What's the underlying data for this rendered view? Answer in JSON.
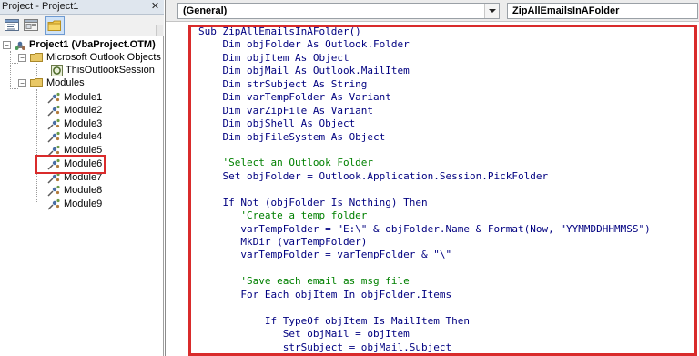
{
  "project_pane": {
    "title": "Project - Project1",
    "close_glyph": "✕",
    "toolbar": {
      "view_code_icon": "view-code-icon",
      "view_object_icon": "view-object-icon",
      "toggle_folders_icon": "folder-icon"
    },
    "tree": {
      "project_label": "Project1 (VbaProject.OTM)",
      "outlook_objects_label": "Microsoft Outlook Objects",
      "this_session_label": "ThisOutlookSession",
      "modules_label": "Modules",
      "modules": [
        "Module1",
        "Module2",
        "Module3",
        "Module4",
        "Module5",
        "Module6",
        "Module7",
        "Module8",
        "Module9"
      ],
      "selected_module": "Module6"
    }
  },
  "code_window": {
    "object_combo": "(General)",
    "procedure_combo": "ZipAllEmailsInAFolder",
    "lines": [
      "Sub ZipAllEmailsInAFolder()",
      "    Dim objFolder As Outlook.Folder",
      "    Dim objItem As Object",
      "    Dim objMail As Outlook.MailItem",
      "    Dim strSubject As String",
      "    Dim varTempFolder As Variant",
      "    Dim varZipFile As Variant",
      "    Dim objShell As Object",
      "    Dim objFileSystem As Object",
      "",
      "    'Select an Outlook Folder",
      "    Set objFolder = Outlook.Application.Session.PickFolder",
      "",
      "    If Not (objFolder Is Nothing) Then",
      "       'Create a temp folder",
      "       varTempFolder = \"E:\\\" & objFolder.Name & Format(Now, \"YYMMDDHHMMSS\")",
      "       MkDir (varTempFolder)",
      "       varTempFolder = varTempFolder & \"\\\"",
      "",
      "       'Save each email as msg file",
      "       For Each objItem In objFolder.Items",
      "",
      "           If TypeOf objItem Is MailItem Then",
      "              Set objMail = objItem",
      "              strSubject = objMail.Subject"
    ],
    "comment_line_indexes": [
      10,
      14,
      19
    ],
    "colors": {
      "code_text": "#000080",
      "comment": "#008000",
      "highlight_border": "#d92b2b"
    }
  }
}
